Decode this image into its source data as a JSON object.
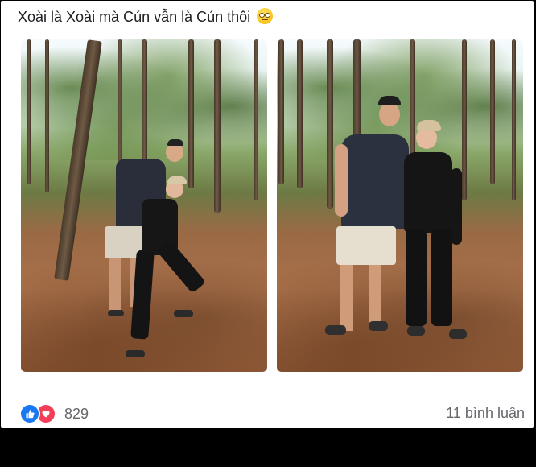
{
  "post": {
    "caption": "Xoài là Xoài mà Cún vẫn là Cún thôi",
    "caption_emoji": "rolling-eyes-emoji",
    "reaction_count": "829",
    "comments_label": "11 bình luận"
  },
  "reactions": [
    {
      "name": "like",
      "icon": "thumbs-up-icon",
      "color": "#1877f2"
    },
    {
      "name": "love",
      "icon": "heart-icon",
      "color": "#f33e58"
    }
  ],
  "colors": {
    "text_primary": "#1c1e21",
    "text_secondary": "#65676b",
    "card_bg": "#ffffff"
  }
}
